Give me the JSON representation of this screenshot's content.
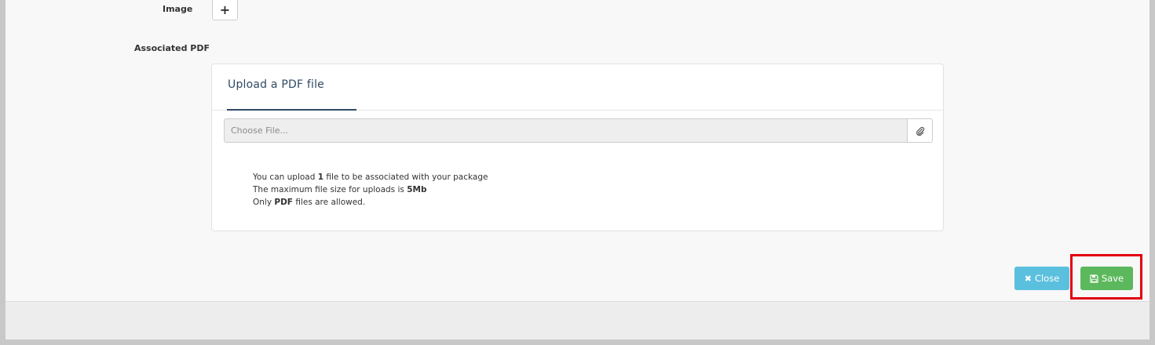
{
  "form": {
    "image_label": "Image",
    "add_image_symbol": "+",
    "associated_pdf_label": "Associated PDF"
  },
  "upload_card": {
    "title": "Upload a PDF file",
    "file_input_placeholder": "Choose File...",
    "info": {
      "line1_prefix": "You can upload ",
      "line1_count": "1",
      "line1_suffix": " file to be associated with your package",
      "line2_prefix": "The maximum file size for uploads is ",
      "line2_size": "5Mb",
      "line3_prefix": "Only ",
      "line3_type": "PDF",
      "line3_suffix": " files are allowed."
    }
  },
  "actions": {
    "close_label": "Close",
    "close_icon": "✖",
    "save_label": "Save",
    "save_icon": "floppy-disk"
  },
  "colors": {
    "close_button": "#5bc0de",
    "save_button": "#5cb85c",
    "highlight": "#e3000f",
    "title": "#2f4a63"
  }
}
